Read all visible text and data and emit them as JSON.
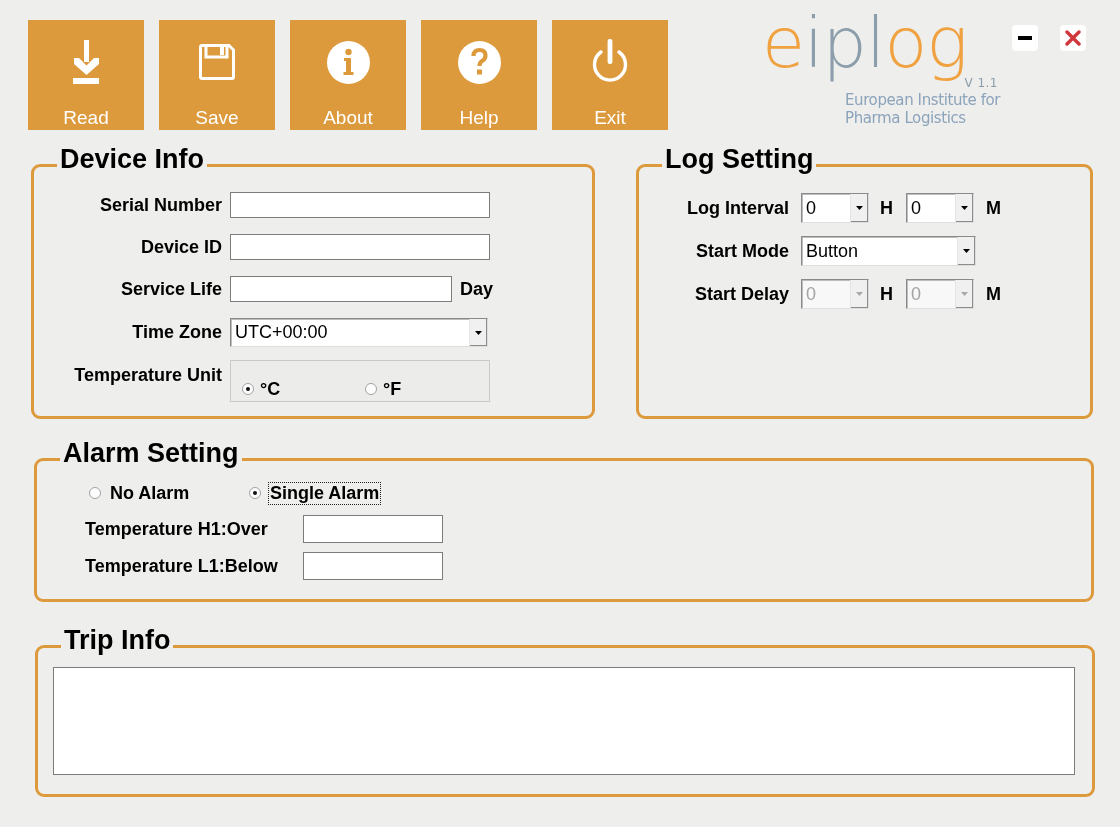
{
  "toolbar": [
    {
      "label": "Read",
      "kind": "download"
    },
    {
      "label": "Save",
      "kind": "save"
    },
    {
      "label": "About",
      "kind": "info"
    },
    {
      "label": "Help",
      "kind": "help"
    },
    {
      "label": "Exit",
      "kind": "power"
    }
  ],
  "logo": {
    "wordmark": [
      "e",
      "ipl",
      "og"
    ],
    "version": "V 1.1",
    "tagline": [
      "European Institute for",
      "Pharma Logistics"
    ]
  },
  "device_info": {
    "title": "Device Info",
    "fields": [
      {
        "label": "Serial Number",
        "kind": "text"
      },
      {
        "label": "Device ID",
        "kind": "text"
      },
      {
        "label": "Service Life",
        "kind": "text",
        "unit": "Day"
      },
      {
        "label": "Time Zone",
        "kind": "select",
        "value": "UTC+00:00"
      },
      {
        "label": "Temperature Unit",
        "kind": "radio",
        "options": [
          {
            "label": "°C",
            "selected": true
          },
          {
            "label": "°F",
            "selected": false
          }
        ]
      }
    ]
  },
  "log_setting": {
    "title": "Log Setting",
    "rows": [
      {
        "label": "Log Interval",
        "kind": "duration",
        "disabled": false,
        "hours": "0",
        "hours_unit": "H",
        "minutes": "0",
        "minutes_unit": "M"
      },
      {
        "label": "Start Mode",
        "kind": "select",
        "disabled": false,
        "value": "Button"
      },
      {
        "label": "Start Delay",
        "kind": "duration",
        "disabled": true,
        "hours": "0",
        "hours_unit": "H",
        "minutes": "0",
        "minutes_unit": "M"
      }
    ]
  },
  "alarm_setting": {
    "title": "Alarm Setting",
    "modes": [
      {
        "label": "No Alarm",
        "selected": false,
        "focused": false
      },
      {
        "label": "Single Alarm",
        "selected": true,
        "focused": true
      }
    ],
    "thresholds": [
      {
        "label": "Temperature H1:Over"
      },
      {
        "label": "Temperature L1:Below"
      }
    ]
  },
  "trip_info": {
    "title": "Trip Info"
  }
}
